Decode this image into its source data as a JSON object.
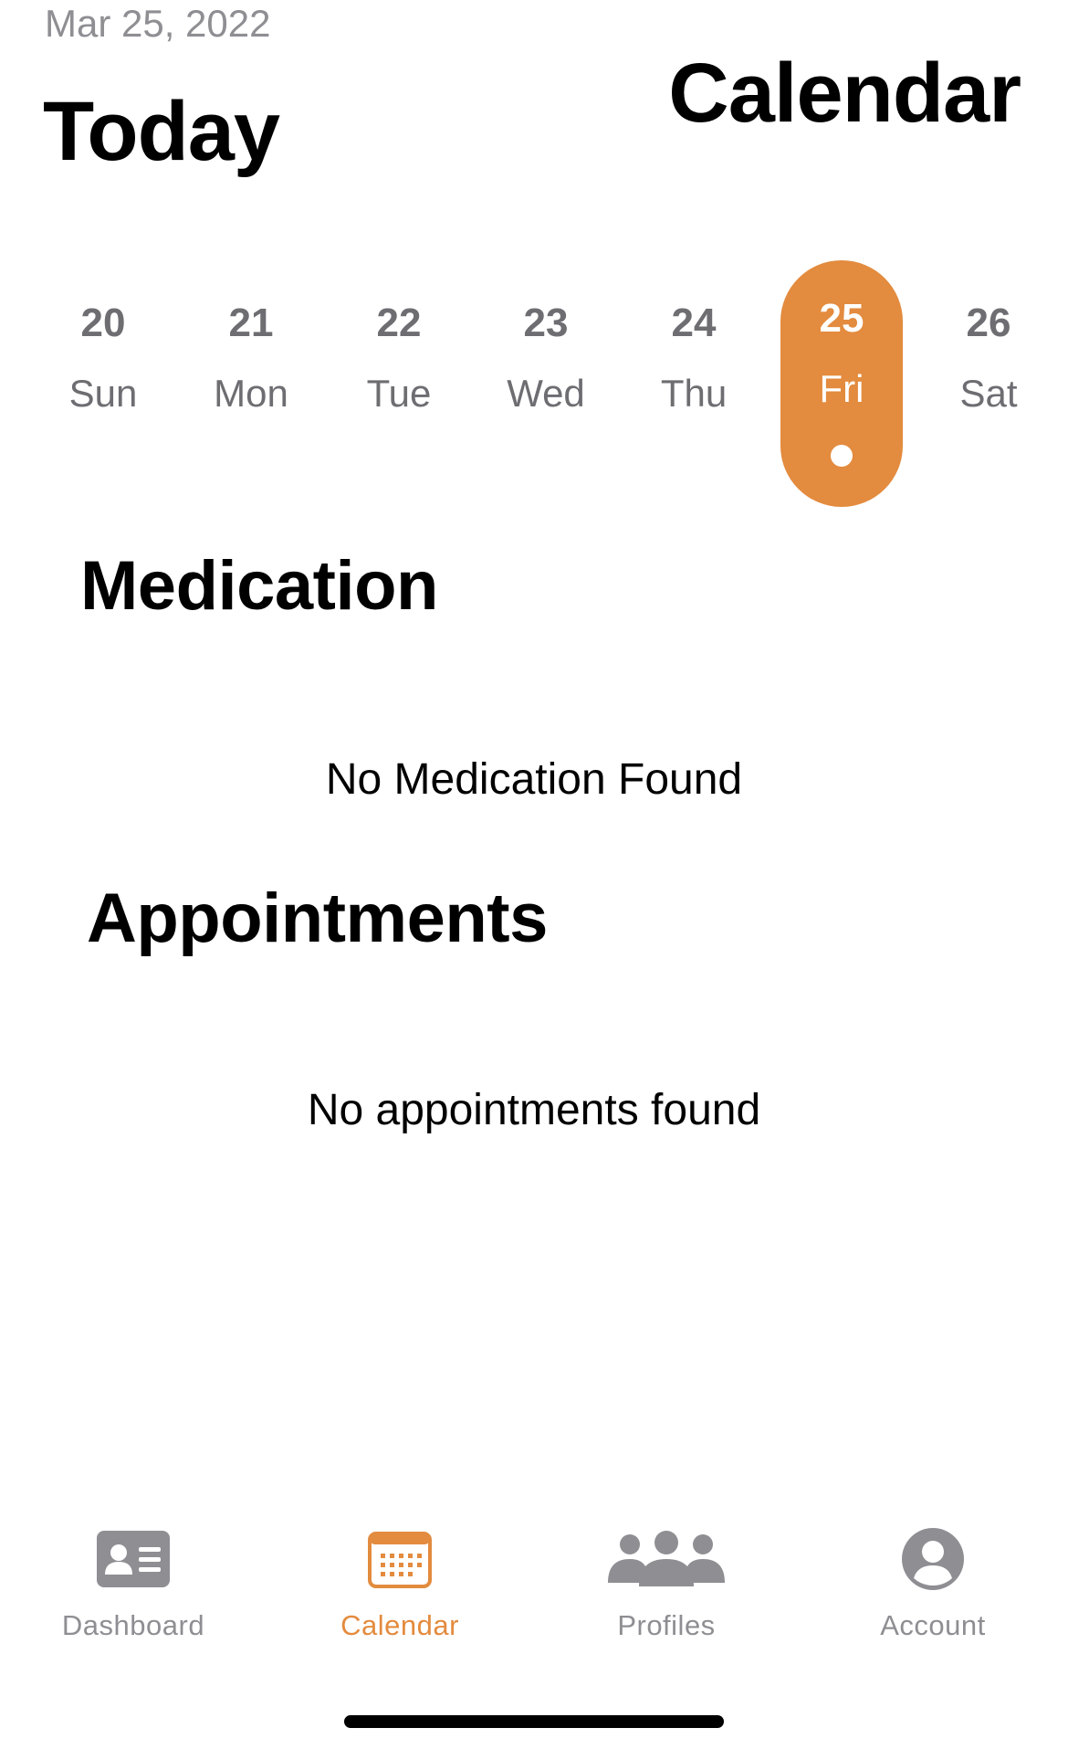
{
  "header": {
    "date": "Mar 25, 2022",
    "today_label": "Today",
    "screen_title": "Calendar"
  },
  "week": {
    "days": [
      {
        "num": "20",
        "name": "Sun",
        "selected": false
      },
      {
        "num": "21",
        "name": "Mon",
        "selected": false
      },
      {
        "num": "22",
        "name": "Tue",
        "selected": false
      },
      {
        "num": "23",
        "name": "Wed",
        "selected": false
      },
      {
        "num": "24",
        "name": "Thu",
        "selected": false
      },
      {
        "num": "25",
        "name": "Fri",
        "selected": true
      },
      {
        "num": "26",
        "name": "Sat",
        "selected": false
      }
    ]
  },
  "medication": {
    "title": "Medication",
    "empty_text": "No Medication Found"
  },
  "appointments": {
    "title": "Appointments",
    "empty_text": "No appointments found"
  },
  "tab_bar": {
    "tabs": [
      {
        "label": "Dashboard",
        "icon": "id-card-icon",
        "active": false
      },
      {
        "label": "Calendar",
        "icon": "calendar-icon",
        "active": true
      },
      {
        "label": "Profiles",
        "icon": "group-icon",
        "active": false
      },
      {
        "label": "Account",
        "icon": "account-circle-icon",
        "active": false
      }
    ]
  },
  "colors": {
    "accent": "#e38b3e",
    "inactive": "#8e8e93",
    "text": "#000000"
  }
}
